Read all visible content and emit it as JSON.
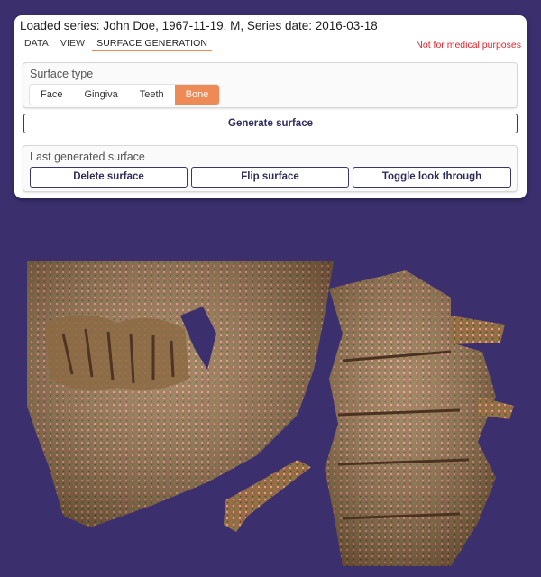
{
  "header": {
    "series_label": "Loaded series:",
    "series_value": "John Doe, 1967-11-19, M, Series date: 2016-03-18",
    "disclaimer": "Not for medical purposes"
  },
  "tabs": [
    {
      "label": "DATA"
    },
    {
      "label": "VIEW"
    },
    {
      "label": "SURFACE GENERATION",
      "active": true
    }
  ],
  "surface_type": {
    "title": "Surface type",
    "options": [
      "Face",
      "Gingiva",
      "Teeth",
      "Bone"
    ],
    "selected": "Bone"
  },
  "generate_label": "Generate surface",
  "last_surface": {
    "title": "Last generated surface",
    "delete_label": "Delete surface",
    "flip_label": "Flip surface",
    "toggle_label": "Toggle look through"
  },
  "colors": {
    "background": "#3b2f6e",
    "accent": "#ee8a55",
    "disclaimer": "#e8232a",
    "bone": "#b07a52",
    "bone_green": "#6f8a3c"
  }
}
